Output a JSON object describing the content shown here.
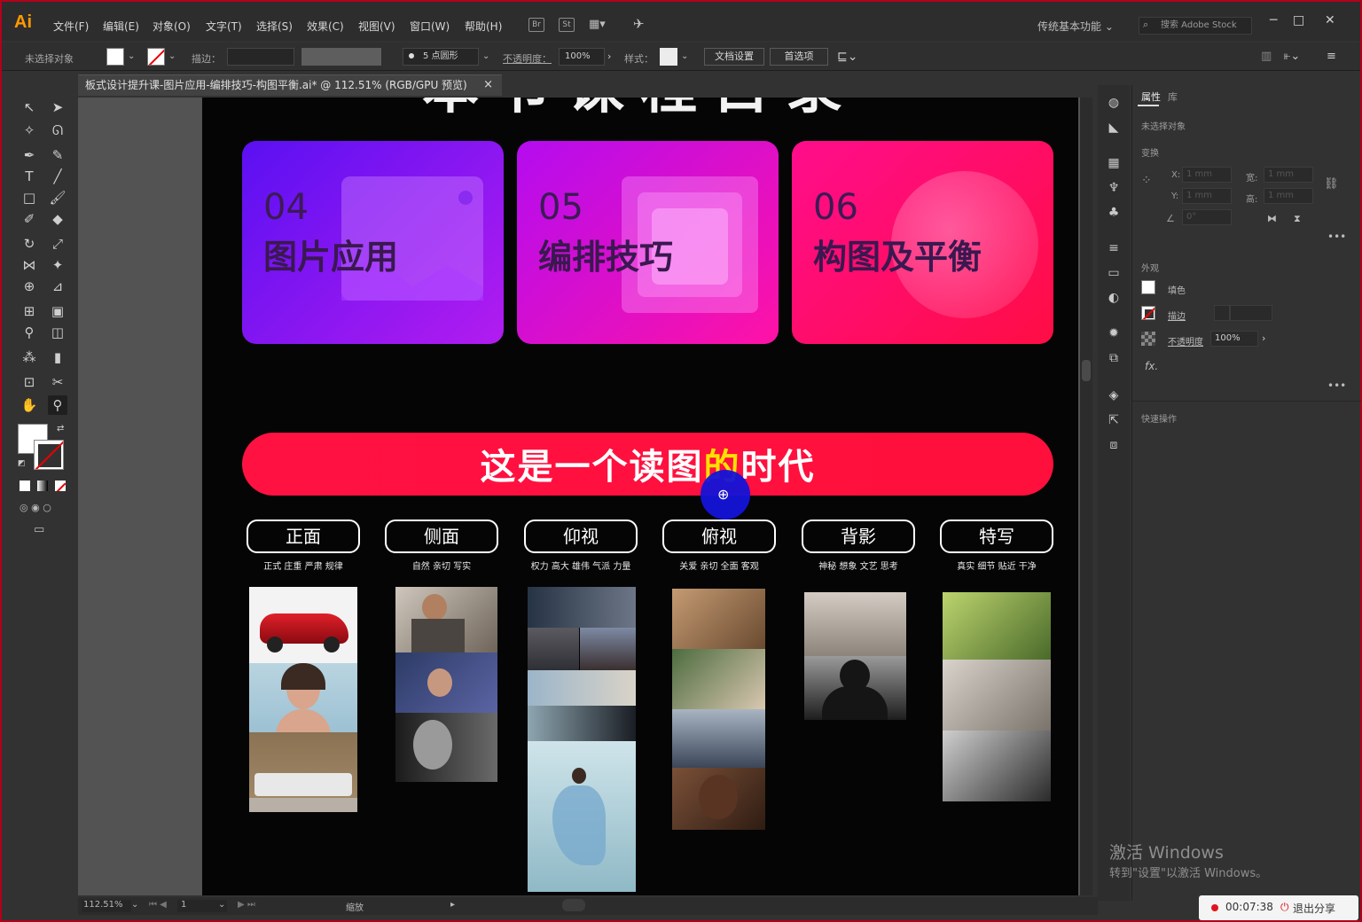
{
  "app": {
    "logo": "Ai",
    "menus": [
      "文件(F)",
      "编辑(E)",
      "对象(O)",
      "文字(T)",
      "选择(S)",
      "效果(C)",
      "视图(V)",
      "窗口(W)",
      "帮助(H)"
    ],
    "bridge_label": "Br",
    "stock_label": "St",
    "workspace": "传统基本功能",
    "stock_search_placeholder": "搜索 Adobe Stock"
  },
  "control_bar": {
    "no_selection": "未选择对象",
    "stroke_label": "描边：",
    "brush_label": "5 点圆形",
    "opacity_label": "不透明度：",
    "opacity_value": "100%",
    "style_label": "样式：",
    "doc_setup": "文档设置",
    "preferences": "首选项"
  },
  "document": {
    "tab_title": "板式设计提升课-图片应用-编排技巧-构图平衡.ai* @ 112.51% (RGB/GPU 预览)",
    "title_partial": "本节课程目录",
    "cards": [
      {
        "num": "04",
        "name": "图片应用",
        "color_a": "#5a10f2",
        "color_b": "#b21cf0"
      },
      {
        "num": "05",
        "name": "编排技巧",
        "color_a": "#b40cf0",
        "color_b": "#ff12a6"
      },
      {
        "num": "06",
        "name": "构图及平衡",
        "color_a": "#ff0d8c",
        "color_b": "#ff0d44"
      }
    ],
    "banner": "这是一个读图的时代",
    "banner_highlight": "的",
    "angles": [
      {
        "label": "正面",
        "sub": "正式  庄重  严肃  规律"
      },
      {
        "label": "侧面",
        "sub": "自然  亲切  写实"
      },
      {
        "label": "仰视",
        "sub": "权力 高大 雄伟  气派  力量"
      },
      {
        "label": "俯视",
        "sub": "关爱  亲切 全面  客观"
      },
      {
        "label": "背影",
        "sub": "神秘  想象 文艺  思考"
      },
      {
        "label": "特写",
        "sub": "真实  细节  贴近  干净"
      }
    ]
  },
  "properties_panel": {
    "tab_properties": "属性",
    "tab_library": "库",
    "no_selection": "未选择对象",
    "transform": "变换",
    "x_label": "X:",
    "x_value": "1 mm",
    "y_label": "Y:",
    "y_value": "1 mm",
    "w_label": "宽:",
    "w_value": "1 mm",
    "h_label": "高:",
    "h_value": "1 mm",
    "angle_value": "0°",
    "appearance": "外观",
    "fill": "填色",
    "stroke": "描边",
    "opacity": "不透明度",
    "opacity_value": "100%",
    "fx": "fx.",
    "quick_actions": "快速操作"
  },
  "status": {
    "zoom": "112.51%",
    "artboard": "1",
    "tool_name": "缩放"
  },
  "overlay": {
    "activate_title": "激活 Windows",
    "activate_sub": "转到\"设置\"以激活 Windows。",
    "rec_time": "00:07:38",
    "rec_exit": "退出分享"
  }
}
